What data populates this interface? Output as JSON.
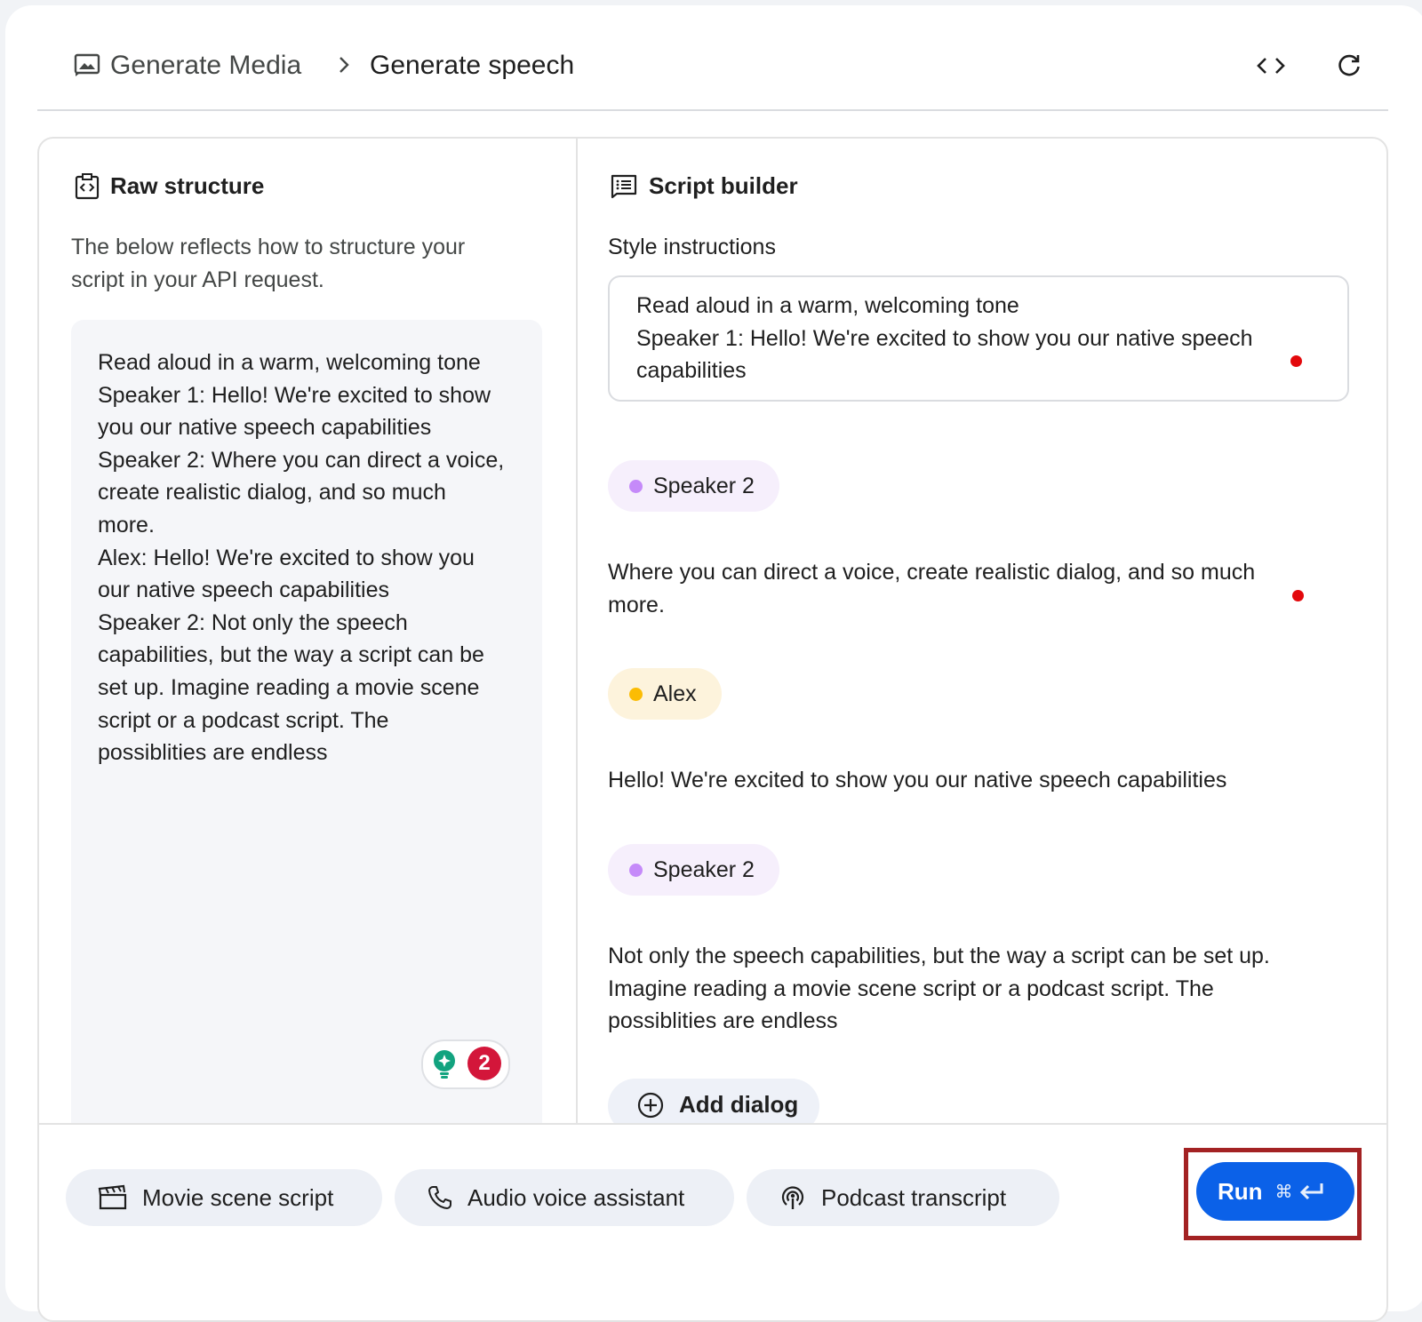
{
  "header": {
    "breadcrumb_root": "Generate Media",
    "breadcrumb_page": "Generate speech"
  },
  "raw_panel": {
    "title": "Raw structure",
    "description": "The below reflects how to structure your script in your API request.",
    "content": "Read aloud in a warm, welcoming tone\nSpeaker 1: Hello! We're excited to show\nyou our native speech capabilities\nSpeaker 2: Where you can direct a voice,\ncreate realistic dialog, and so much\nmore.\nAlex: Hello! We're excited to show you\nour native speech capabilities\nSpeaker 2: Not only the speech\ncapabilities, but the way a script can be\nset up. Imagine reading a movie scene\nscript or a podcast script. The\npossiblities are endless",
    "extension_badge_count": "2"
  },
  "script_panel": {
    "title": "Script builder",
    "style_label": "Style instructions",
    "style_value": "Read aloud in a warm, welcoming tone\nSpeaker 1: Hello! We're excited to show you our native speech\ncapabilities",
    "dialogs": [
      {
        "speaker": "Speaker 2",
        "color": "#c58af9",
        "chip_bg": "#f6effc",
        "text": "Where you can direct a voice, create realistic dialog, and so much more."
      },
      {
        "speaker": "Alex",
        "color": "#fbbc04",
        "chip_bg": "#fdf3dc",
        "text": "Hello! We're excited to show you our native speech capabilities"
      },
      {
        "speaker": "Speaker 2",
        "color": "#c58af9",
        "chip_bg": "#f6effc",
        "text": "Not only the speech capabilities, but the way a script can be set up. Imagine reading a movie scene script or a podcast script. The possiblities are endless"
      }
    ],
    "add_dialog_label": "Add dialog"
  },
  "footer": {
    "presets": [
      {
        "label": "Movie scene script",
        "icon": "clapperboard-icon"
      },
      {
        "label": "Audio voice assistant",
        "icon": "phone-icon"
      },
      {
        "label": "Podcast transcript",
        "icon": "podcast-icon"
      }
    ],
    "run_label": "Run",
    "run_shortcut": "⌘"
  },
  "colors": {
    "run_button": "#0b61e8",
    "highlight_frame": "#a32223",
    "dirty_dot": "#e3090c"
  }
}
